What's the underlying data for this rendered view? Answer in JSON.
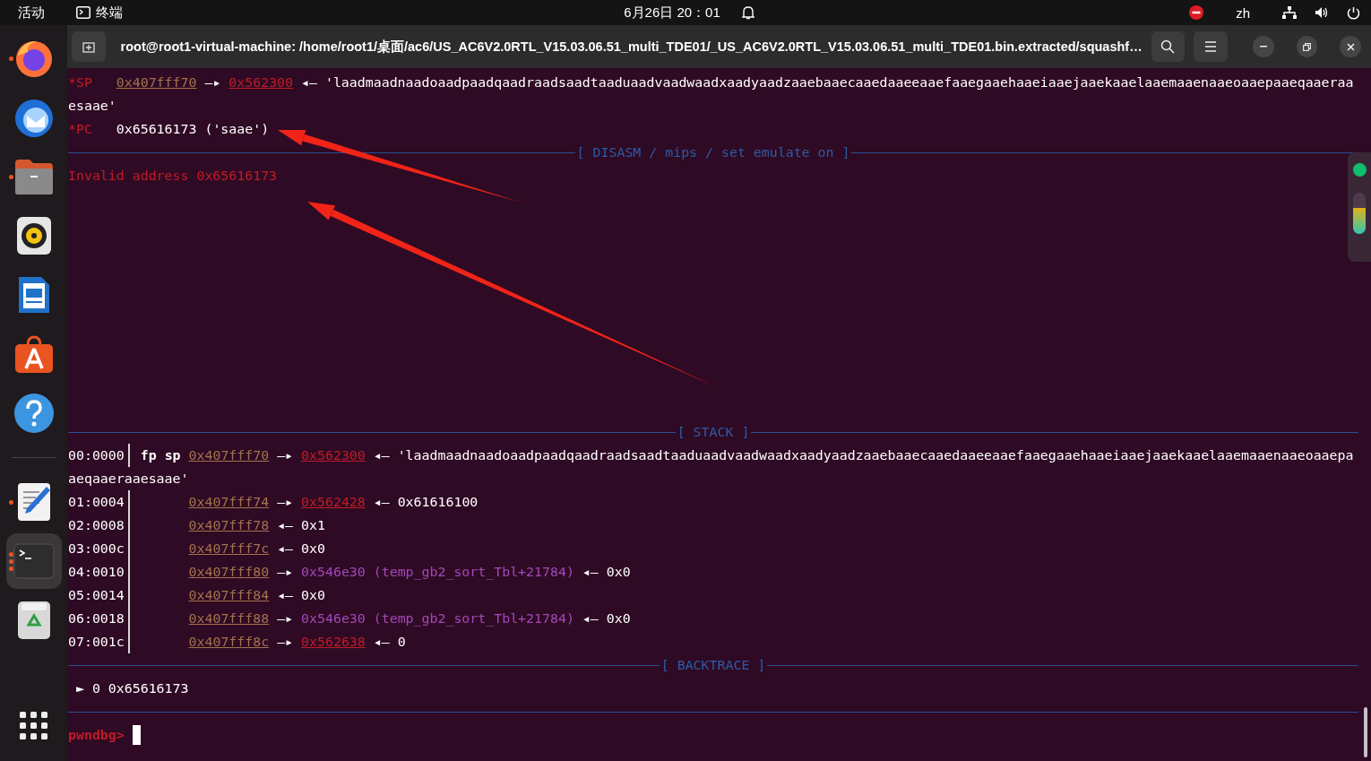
{
  "top_bar": {
    "activities": "活动",
    "app": "终端",
    "clock": "6月26日 20：01",
    "input_method": "zh"
  },
  "dock": {
    "groups": [
      {
        "items": [
          {
            "kind": "browser",
            "running": true,
            "selected": false
          },
          {
            "kind": "mail",
            "running": false,
            "selected": false
          },
          {
            "kind": "folder",
            "running": true,
            "selected": false
          },
          {
            "kind": "speaker",
            "running": false,
            "selected": false
          },
          {
            "kind": "document",
            "running": false,
            "selected": false
          },
          {
            "kind": "store",
            "running": false,
            "selected": false
          },
          {
            "kind": "help",
            "running": false,
            "selected": false
          }
        ]
      },
      {
        "items": [
          {
            "kind": "editor",
            "running": true,
            "selected": false
          },
          {
            "kind": "terminal",
            "running": true,
            "selected": true
          },
          {
            "kind": "trash",
            "running": false,
            "selected": false
          }
        ]
      }
    ]
  },
  "window": {
    "title": "root@root1-virtual-machine: /home/root1/桌面/ac6/US_AC6V2.0RTL_V15.03.06.51_multi_TDE01/_US_AC6V2.0RTL_V15.03.06.51_multi_TDE01.bin.extracted/squashf…"
  },
  "terminal": {
    "top_lines": [
      {
        "kind": "text",
        "segments": [
          {
            "kind": "reg",
            "text": "*SP   "
          },
          {
            "kind": "addr",
            "text": "0x407fff70"
          },
          {
            "kind": "plain",
            "text": " —▸ "
          },
          {
            "kind": "heap",
            "text": "0x562300"
          },
          {
            "kind": "plain",
            "text": " ◂— 'laadmaadnaadoaadpaadqaadraadsaadtaaduaadvaadwaadxaadyaadzaaebaaecaaedaaeeaaefaaegaaehaaeiaaejaaekaaelaaemaaenaaeoaaepaaeqaaeraa"
          }
        ]
      },
      {
        "kind": "text",
        "segments": [
          {
            "kind": "plain",
            "text": "esaae'"
          }
        ]
      },
      {
        "kind": "text",
        "segments": [
          {
            "kind": "reg",
            "text": "*PC   "
          },
          {
            "kind": "plain",
            "text": "0x65616173 ('saae')"
          }
        ]
      },
      {
        "kind": "banner",
        "label": "[ DISASM / mips / set emulate on ]"
      },
      {
        "kind": "text",
        "segments": [
          {
            "kind": "error",
            "text": "Invalid address 0x65616173"
          }
        ]
      }
    ],
    "bottom_lines": [
      {
        "kind": "banner",
        "label": "[ STACK ]"
      },
      {
        "kind": "stack",
        "offset": "00:0000",
        "pointers": "fp sp",
        "segments": [
          {
            "kind": "addr",
            "text": "0x407fff70"
          },
          {
            "kind": "plain",
            "text": " —▸ "
          },
          {
            "kind": "heap",
            "text": "0x562300"
          },
          {
            "kind": "plain",
            "text": " ◂— 'laadmaadnaadoaadpaadqaadraadsaadtaaduaadvaadwaadxaadyaadzaaebaaecaaedaaeeaaefaaegaaehaaeiaaejaaekaaelaaemaaenaaeoaaepa"
          }
        ]
      },
      {
        "kind": "text",
        "segments": [
          {
            "kind": "plain",
            "text": "aeqaaeraaesaae'"
          }
        ]
      },
      {
        "kind": "stack",
        "offset": "01:0004",
        "segments": [
          {
            "kind": "addr",
            "text": "0x407fff74"
          },
          {
            "kind": "plain",
            "text": " —▸ "
          },
          {
            "kind": "heap",
            "text": "0x562428"
          },
          {
            "kind": "plain",
            "text": " ◂— 0x61616100"
          }
        ]
      },
      {
        "kind": "stack",
        "offset": "02:0008",
        "segments": [
          {
            "kind": "addr",
            "text": "0x407fff78"
          },
          {
            "kind": "plain",
            "text": " ◂— 0x1"
          }
        ]
      },
      {
        "kind": "stack",
        "offset": "03:000c",
        "segments": [
          {
            "kind": "addr",
            "text": "0x407fff7c"
          },
          {
            "kind": "plain",
            "text": " ◂— 0x0"
          }
        ]
      },
      {
        "kind": "stack",
        "offset": "04:0010",
        "segments": [
          {
            "kind": "addr",
            "text": "0x407fff80"
          },
          {
            "kind": "plain",
            "text": " —▸ "
          },
          {
            "kind": "data",
            "text": "0x546e30 (temp_gb2_sort_Tbl+21784)"
          },
          {
            "kind": "plain",
            "text": " ◂— 0x0"
          }
        ]
      },
      {
        "kind": "stack",
        "offset": "05:0014",
        "segments": [
          {
            "kind": "addr",
            "text": "0x407fff84"
          },
          {
            "kind": "plain",
            "text": " ◂— 0x0"
          }
        ]
      },
      {
        "kind": "stack",
        "offset": "06:0018",
        "segments": [
          {
            "kind": "addr",
            "text": "0x407fff88"
          },
          {
            "kind": "plain",
            "text": " —▸ "
          },
          {
            "kind": "data",
            "text": "0x546e30 (temp_gb2_sort_Tbl+21784)"
          },
          {
            "kind": "plain",
            "text": " ◂— 0x0"
          }
        ]
      },
      {
        "kind": "stack",
        "offset": "07:001c",
        "segments": [
          {
            "kind": "addr",
            "text": "0x407fff8c"
          },
          {
            "kind": "plain",
            "text": " —▸ "
          },
          {
            "kind": "heap",
            "text": "0x562638"
          },
          {
            "kind": "plain",
            "text": " ◂— 0"
          }
        ]
      },
      {
        "kind": "banner",
        "label": "[ BACKTRACE ]"
      },
      {
        "kind": "text",
        "segments": [
          {
            "kind": "plain",
            "text": " ► 0 0x65616173"
          }
        ]
      },
      {
        "kind": "rule"
      },
      {
        "kind": "prompt",
        "prompt": "pwndbg>"
      }
    ]
  },
  "side_widget": {
    "level": 0.62
  }
}
